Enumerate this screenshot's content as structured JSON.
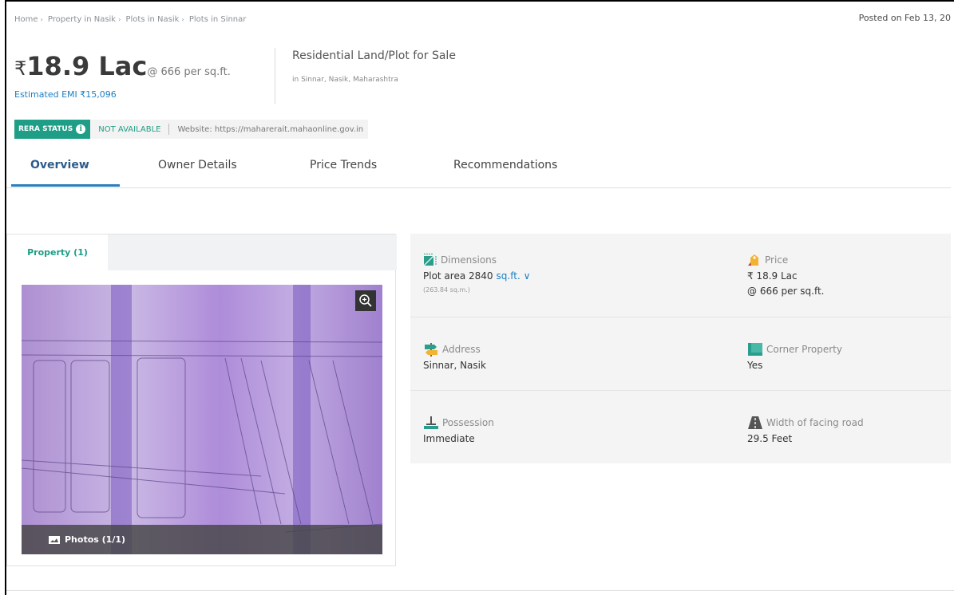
{
  "breadcrumb": [
    "Home",
    "Property in Nasik",
    "Plots in Nasik",
    "Plots in Sinnar"
  ],
  "posted": "Posted on Feb 13, 20",
  "price": {
    "currency": "₹",
    "amount": "18.9 Lac",
    "per_sqft": "@ 666 per sq.ft.",
    "emi": "Estimated EMI ₹15,096"
  },
  "property": {
    "title": "Residential Land/Plot for Sale",
    "location": "in Sinnar, Nasik, Maharashtra"
  },
  "rera": {
    "badge": "RERA STATUS",
    "info_glyph": "i",
    "status": "NOT AVAILABLE",
    "website": "Website: https://maharerait.mahaonline.gov.in"
  },
  "tabs": [
    {
      "label": "Overview",
      "active": true
    },
    {
      "label": "Owner Details",
      "active": false
    },
    {
      "label": "Price Trends",
      "active": false
    },
    {
      "label": "Recommendations",
      "active": false
    }
  ],
  "gallery": {
    "tab_label": "Property (1)",
    "photos_label": "Photos (1/1)"
  },
  "details": {
    "dimensions": {
      "label": "Dimensions",
      "value": "Plot area 2840",
      "unit": "sq.ft. ∨",
      "sub": "(263.84 sq.m.)",
      "icon": "dimensions-icon"
    },
    "price": {
      "label": "Price",
      "value": "₹ 18.9 Lac",
      "sub": "@ 666 per sq.ft.",
      "icon": "price-tag-icon"
    },
    "address": {
      "label": "Address",
      "value": "Sinnar, Nasik",
      "icon": "signpost-icon"
    },
    "corner": {
      "label": "Corner Property",
      "value": "Yes",
      "icon": "corner-icon"
    },
    "possession": {
      "label": "Possession",
      "value": "Immediate",
      "icon": "possession-icon"
    },
    "road": {
      "label": "Width of facing road",
      "value": "29.5 Feet",
      "icon": "road-icon"
    }
  },
  "colors": {
    "accent_green": "#1e9e86",
    "link_blue": "#1b7fc4",
    "tab_active": "#2d5c8a"
  }
}
